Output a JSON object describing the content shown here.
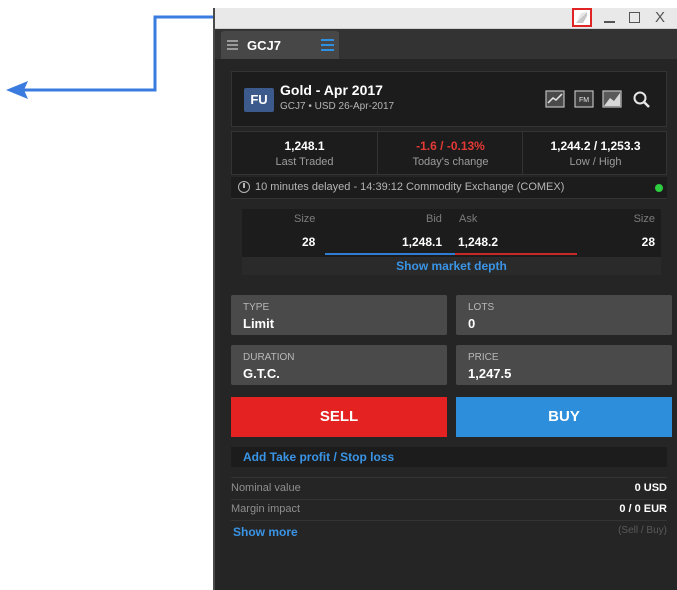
{
  "window": {
    "controls": {
      "detach_icon": "detach-icon",
      "minimize": "_",
      "maximize": "□",
      "close": "X"
    }
  },
  "tab": {
    "label": "GCJ7",
    "grip_icon": "grip-icon",
    "menu_icon": "hamburger-menu-icon"
  },
  "instrument": {
    "badge": "FU",
    "name": "Gold - Apr 2017",
    "sub": "GCJ7 • USD  26-Apr-2017",
    "icons": [
      "chart-icon",
      "fundamentals-icon",
      "price-chart-icon",
      "search-icon"
    ]
  },
  "stats": [
    {
      "value": "1,248.1",
      "label": "Last Traded"
    },
    {
      "value": "-1.6 / -0.13%",
      "label": "Today's change"
    },
    {
      "value": "1,244.2 / 1,253.3",
      "label": "Low / High"
    }
  ],
  "delay": {
    "text": "10 minutes delayed - 14:39:12 Commodity Exchange (COMEX)",
    "status_color": "#2ecc40"
  },
  "depth": {
    "headers": {
      "size_left": "Size",
      "bid": "Bid",
      "ask": "Ask",
      "size_right": "Size"
    },
    "bid_size": "28",
    "bid": "1,248.1",
    "ask": "1,248.2",
    "ask_size": "28",
    "link": "Show market depth"
  },
  "order": {
    "type": {
      "label": "TYPE",
      "value": "Limit"
    },
    "lots": {
      "label": "LOTS",
      "value": "0"
    },
    "duration": {
      "label": "DURATION",
      "value": "G.T.C."
    },
    "price": {
      "label": "PRICE",
      "value": "1,247.5"
    }
  },
  "actions": {
    "sell": "SELL",
    "buy": "BUY",
    "sell_color": "#e52222",
    "buy_color": "#2d8fdc"
  },
  "take_profit_link": "Add Take profit / Stop loss",
  "summary": [
    {
      "label": "Nominal value",
      "value": "0 USD"
    },
    {
      "label": "Margin impact",
      "value": "0 / 0 EUR"
    }
  ],
  "show_more": "Show more",
  "sell_buy_note": "(Sell / Buy)",
  "annotation_color": "#3a7be0",
  "highlight_color": "#e02424"
}
